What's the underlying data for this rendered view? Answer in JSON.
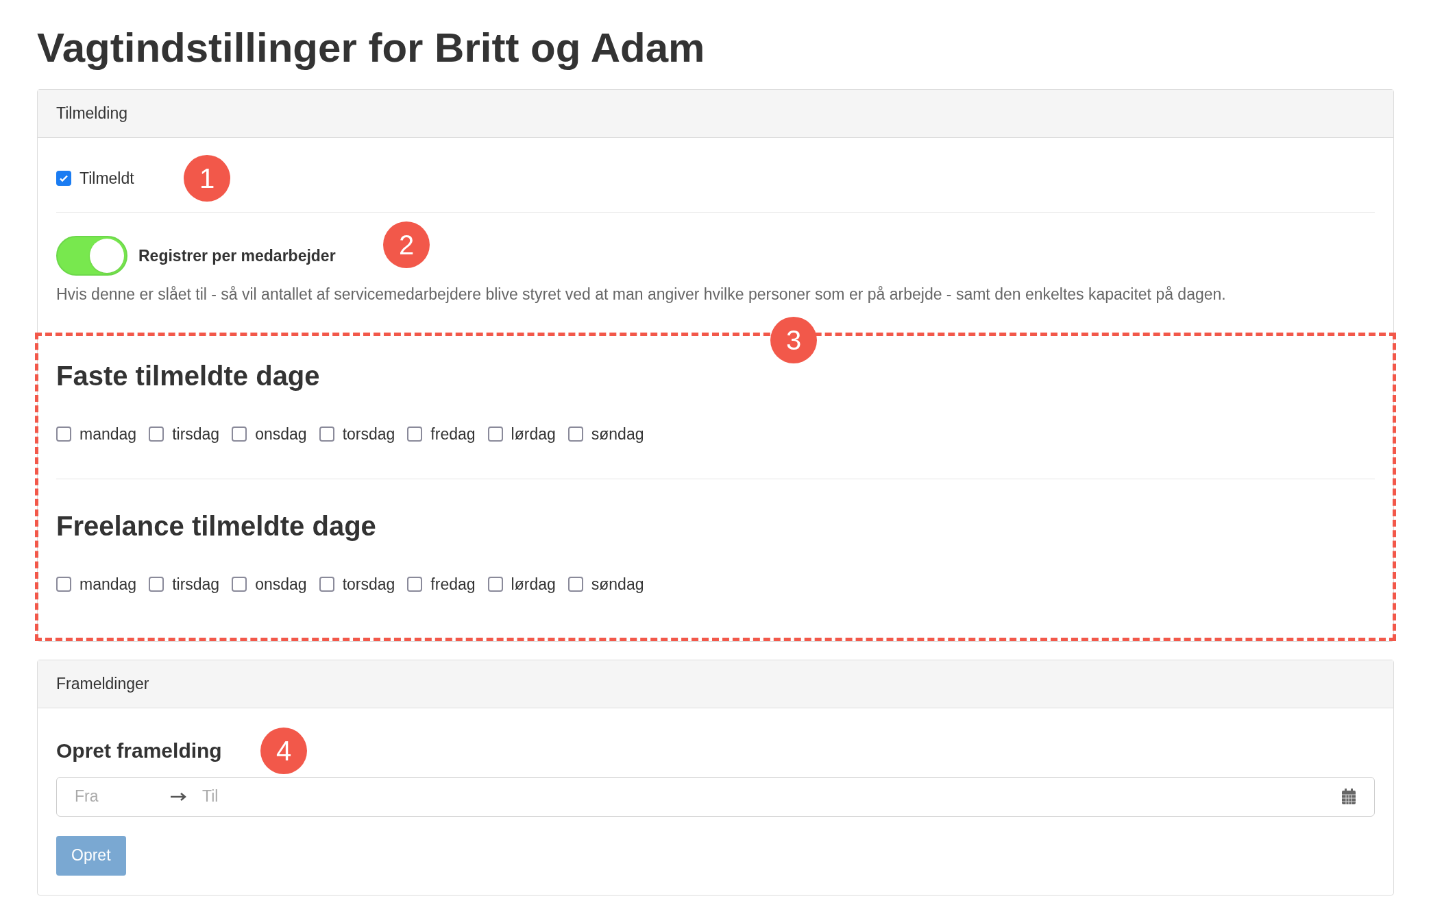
{
  "title": "Vagtindstillinger for Britt og Adam",
  "signup_panel": {
    "header": "Tilmelding",
    "enrolled": {
      "label": "Tilmeldt",
      "checked": true,
      "marker": "1"
    },
    "per_employee": {
      "label": "Registrer per medarbejder",
      "on": true,
      "marker": "2",
      "description": "Hvis denne er slået til - så vil antallet af servicemedarbejdere blive styret ved at man angiver hvilke personer som er på arbejde - samt den enkeltes kapacitet på dagen."
    },
    "highlight_marker": "3",
    "day_groups": [
      {
        "heading": "Faste tilmeldte dage",
        "days": [
          {
            "label": "mandag",
            "checked": false
          },
          {
            "label": "tirsdag",
            "checked": false
          },
          {
            "label": "onsdag",
            "checked": false
          },
          {
            "label": "torsdag",
            "checked": false
          },
          {
            "label": "fredag",
            "checked": false
          },
          {
            "label": "lørdag",
            "checked": false
          },
          {
            "label": "søndag",
            "checked": false
          }
        ]
      },
      {
        "heading": "Freelance tilmeldte dage",
        "days": [
          {
            "label": "mandag",
            "checked": false
          },
          {
            "label": "tirsdag",
            "checked": false
          },
          {
            "label": "onsdag",
            "checked": false
          },
          {
            "label": "torsdag",
            "checked": false
          },
          {
            "label": "fredag",
            "checked": false
          },
          {
            "label": "lørdag",
            "checked": false
          },
          {
            "label": "søndag",
            "checked": false
          }
        ]
      }
    ]
  },
  "cancel_panel": {
    "header": "Frameldinger",
    "heading": "Opret framelding",
    "marker": "4",
    "date_range": {
      "from_placeholder": "Fra",
      "to_placeholder": "Til"
    },
    "button": {
      "label": "Opret",
      "disabled": true
    }
  }
}
